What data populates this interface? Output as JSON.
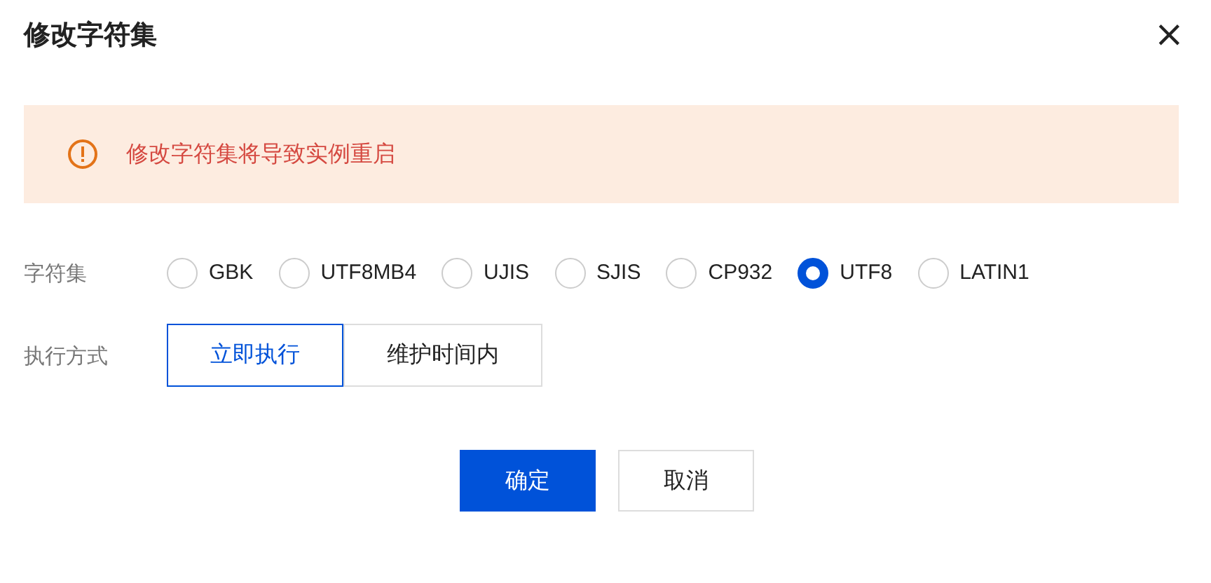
{
  "dialog": {
    "title": "修改字符集",
    "close": "×"
  },
  "alert": {
    "message": "修改字符集将导致实例重启"
  },
  "charset": {
    "label": "字符集",
    "options": [
      {
        "label": "GBK",
        "selected": false
      },
      {
        "label": "UTF8MB4",
        "selected": false
      },
      {
        "label": "UJIS",
        "selected": false
      },
      {
        "label": "SJIS",
        "selected": false
      },
      {
        "label": "CP932",
        "selected": false
      },
      {
        "label": "UTF8",
        "selected": true
      },
      {
        "label": "LATIN1",
        "selected": false
      }
    ]
  },
  "execution": {
    "label": "执行方式",
    "options": [
      {
        "label": "立即执行",
        "selected": true
      },
      {
        "label": "维护时间内",
        "selected": false
      }
    ]
  },
  "buttons": [
    {
      "label": "确定",
      "kind": "primary"
    },
    {
      "label": "取消",
      "kind": "secondary"
    }
  ]
}
